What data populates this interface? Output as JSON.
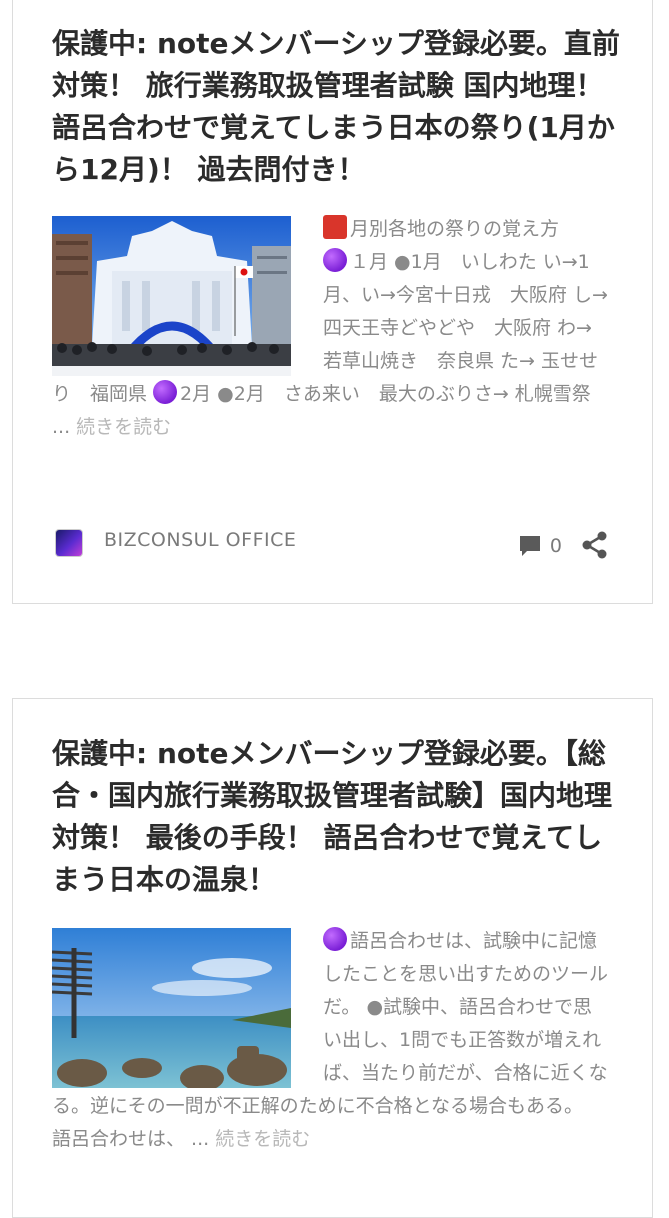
{
  "posts": [
    {
      "title": "保護中: noteメンバーシップ登録必要。直前対策！ 旅行業務取扱管理者試験 国内地理！ 語呂合わせで覚えてしまう日本の祭り(1月から12月)！ 過去問付き！",
      "thumbnail_icon": "snow-sculpture-image",
      "excerpt_head": "月別各地の祭りの覚え方",
      "excerpt_body": "１月 ●1月　いしわた い→1月、い→今宮十日戎　大阪府 し→ 四天王寺どやどや　大阪府 わ→ 若草山焼き　奈良県 た→ 玉せせり　福岡県 ",
      "excerpt_tail": "2月 ●2月　さあ来い　最大のぶりさ→ 札幌雪祭 ...",
      "read_more": "続きを読む",
      "author": "BIZCONSUL OFFICE",
      "comment_count": "0"
    },
    {
      "title": "保護中: noteメンバーシップ登録必要。【総合・国内旅行業務取扱管理者試験】国内地理対策！ 最後の手段！ 語呂合わせで覚えてしまう日本の温泉！",
      "thumbnail_icon": "hot-spring-image",
      "excerpt_body": "語呂合わせは、試験中に記憶したことを思い出すためのツールだ。 ●試験中、語呂合わせで思い出し、1問でも正答数が増えれば、当たり前だが、合格に近くなる。逆にその一問が不正解のために不合格となる場合もある。 語呂合わせは、 ...",
      "read_more": "続きを読む"
    }
  ],
  "colors": {
    "title": "#2b2b2b",
    "excerpt": "#8a8a8a",
    "read_more": "#b8b8b8",
    "border": "#dcdcdc"
  }
}
